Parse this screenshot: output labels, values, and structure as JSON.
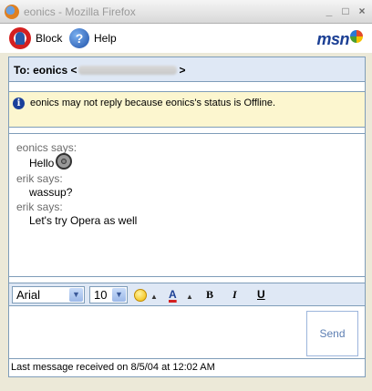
{
  "window": {
    "title": "eonics - Mozilla Firefox",
    "min": "_",
    "max": "□",
    "close": "×"
  },
  "toolbar": {
    "block_label": "Block",
    "help_label": "Help",
    "logo_text": "msn"
  },
  "to_bar": {
    "prefix": "To: eonics <",
    "suffix": ">"
  },
  "notice": {
    "text": "eonics may not reply because eonics's status is Offline."
  },
  "history": [
    {
      "who": "eonics says:",
      "text": "Hello"
    },
    {
      "who": "erik says:",
      "text": "wassup?"
    },
    {
      "who": "erik says:",
      "text": "Let's try Opera as well"
    }
  ],
  "format": {
    "font": "Arial",
    "size": "10",
    "bold": "B",
    "italic": "I",
    "underline": "U",
    "font_color": "A"
  },
  "compose": {
    "value": "",
    "send_label": "Send"
  },
  "status": {
    "text": "Last message received on 8/5/04 at 12:02 AM"
  },
  "colors": {
    "accent": "#1b3f94",
    "header_bg": "#dfe8f5",
    "notice_bg": "#fcf6cf",
    "border": "#7f9db9"
  }
}
